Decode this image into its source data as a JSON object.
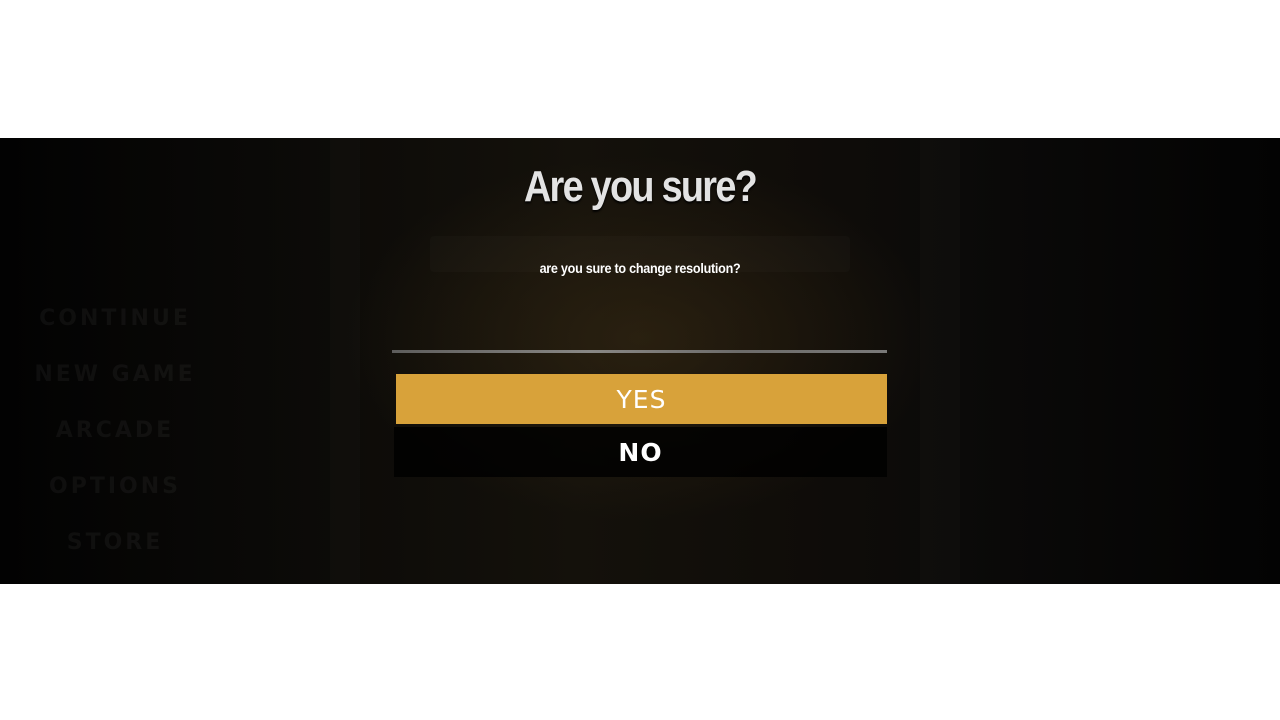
{
  "dialog": {
    "title": "Are you sure?",
    "message": "are you sure to change resolution?",
    "yes_label": "YES",
    "no_label": "NO"
  },
  "background_menu": {
    "items": [
      "CONTINUE",
      "NEW GAME",
      "ARCADE",
      "OPTIONS",
      "STORE"
    ]
  },
  "colors": {
    "accent": "#d8a23a",
    "title": "#e3e3e3",
    "backdrop": "#000000"
  }
}
